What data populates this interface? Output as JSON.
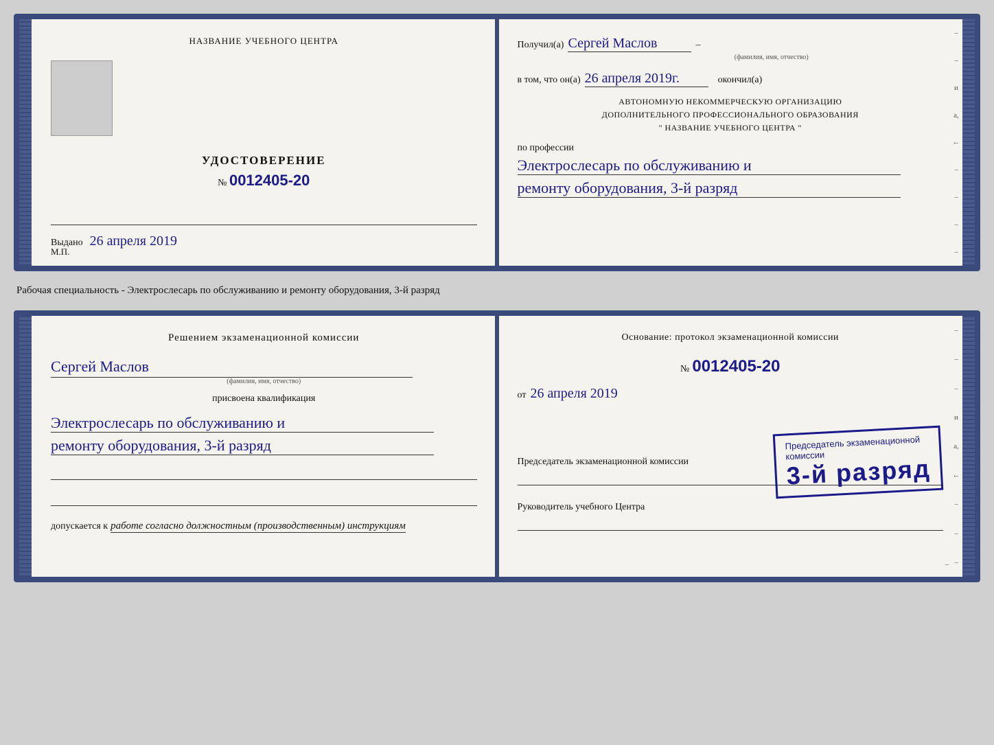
{
  "top_card": {
    "left": {
      "org_name_label": "НАЗВАНИЕ УЧЕБНОГО ЦЕНТРА",
      "photo_alt": "Фото",
      "doc_type_label": "УДОСТОВЕРЕНИЕ",
      "doc_number_prefix": "№",
      "doc_number": "0012405-20",
      "issued_label": "Выдано",
      "issued_date": "26 апреля 2019",
      "mp_label": "М.П."
    },
    "right": {
      "received_label": "Получил(а)",
      "person_name": "Сергей Маслов",
      "person_name_sub": "(фамилия, имя, отчество)",
      "dash": "–",
      "in_that_label": "в том, что он(а)",
      "completed_date": "26 апреля 2019г.",
      "completed_label": "окончил(а)",
      "org_line1": "АВТОНОМНУЮ НЕКОММЕРЧЕСКУЮ ОРГАНИЗАЦИЮ",
      "org_line2": "ДОПОЛНИТЕЛЬНОГО ПРОФЕССИОНАЛЬНОГО ОБРАЗОВАНИЯ",
      "org_name_quoted": "\"    НАЗВАНИЕ УЧЕБНОГО ЦЕНТРА    \"",
      "profession_label": "по профессии",
      "profession_line1": "Электрослесарь по обслуживанию и",
      "profession_line2": "ремонту оборудования, 3-й разряд"
    }
  },
  "between_label": "Рабочая специальность - Электрослесарь по обслуживанию и ремонту оборудования, 3-й разряд",
  "bottom_card": {
    "left": {
      "decision_label": "Решением экзаменационной комиссии",
      "person_name": "Сергей Маслов",
      "person_name_sub": "(фамилия, имя, отчество)",
      "assigned_label": "присвоена квалификация",
      "qualification_line1": "Электрослесарь по обслуживанию и",
      "qualification_line2": "ремонту оборудования, 3-й разряд",
      "sig_line1_label": "",
      "sig_line2_label": "",
      "allowed_label": "допускается к",
      "allowed_value": "работе согласно должностным (производственным) инструкциям"
    },
    "right": {
      "basis_label": "Основание: протокол экзаменационной комиссии",
      "protocol_number_prefix": "№",
      "protocol_number": "0012405-20",
      "date_prefix": "от",
      "date_value": "26 апреля 2019",
      "chairman_label": "Председатель экзаменационной комиссии",
      "head_label": "Руководитель учебного Центра"
    },
    "stamp": {
      "grade_label": "3-й разряд"
    }
  }
}
